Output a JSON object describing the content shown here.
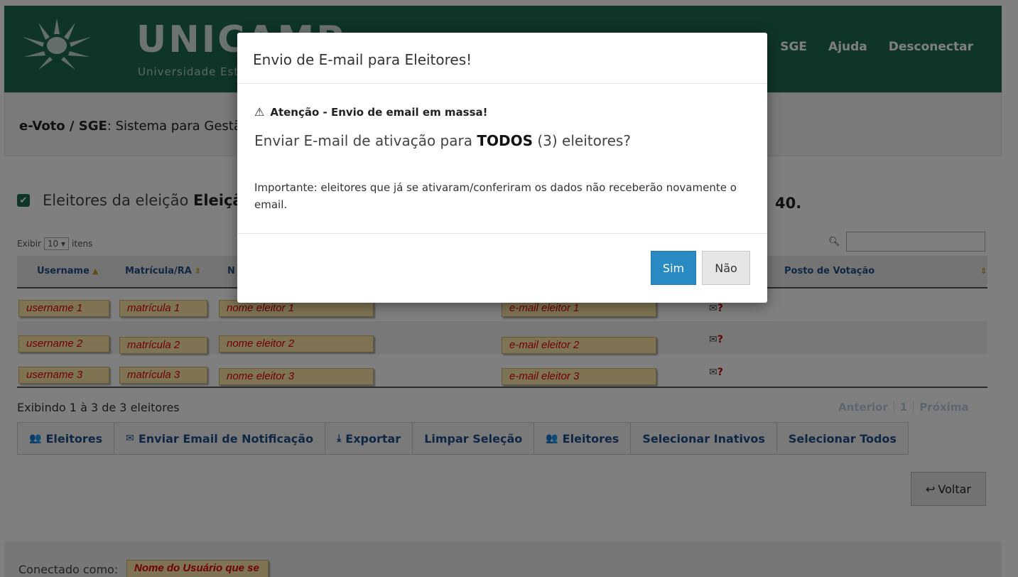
{
  "header": {
    "brand": "UNICAMP",
    "brand_sub": "Universidade Estadual de Campinas",
    "nav": [
      "SGE",
      "Ajuda",
      "Desconectar"
    ]
  },
  "title": {
    "prefix": "e-Voto / SGE",
    "text": ": Sistema para Gestão de Eleições"
  },
  "section": {
    "lead": "Eleitores da eleição",
    "election_name": "Eleição",
    "end_fragment": "40."
  },
  "table_controls": {
    "exibir_label": "Exibir",
    "per_page": "10",
    "itens_label": "itens"
  },
  "columns": [
    {
      "label": "Username",
      "sort": "▲"
    },
    {
      "label": "Matrícula/RA",
      "sort": "⇕"
    },
    {
      "label": "N",
      "sort": ""
    },
    {
      "label": "Posto de Votação",
      "sort": "⇕"
    }
  ],
  "rows": [
    {
      "username": "username 1",
      "matricula": "matrícula 1",
      "nome": "nome eleitor 1",
      "email": "e-mail eleitor 1"
    },
    {
      "username": "username 2",
      "matricula": "matrícula 2",
      "nome": "nome eleitor 2",
      "email": "e-mail eleitor 2"
    },
    {
      "username": "username 3",
      "matricula": "matrícula 3",
      "nome": "nome eleitor 3",
      "email": "e-mail eleitor 3"
    }
  ],
  "row_icons": {
    "envelope": "✉",
    "question": "?"
  },
  "exibindo": "Exibindo 1 à 3 de 3 eleitores",
  "pager": {
    "prev": "Anterior",
    "page": "1",
    "next": "Próxima"
  },
  "actions": [
    {
      "icon": "👥",
      "label": "Eleitores"
    },
    {
      "icon": "✉",
      "label": "Enviar Email de Notificação"
    },
    {
      "icon": "⤓",
      "label": "Exportar"
    },
    {
      "icon": "",
      "label": "Limpar Seleção"
    },
    {
      "icon": "👥",
      "label": "Eleitores"
    },
    {
      "icon": "",
      "label": "Selecionar Inativos"
    },
    {
      "icon": "",
      "label": "Selecionar Todos"
    }
  ],
  "voltar": "Voltar",
  "footer": {
    "connected_as": "Conectado como:",
    "user_tag": "Nome do Usuário que se autenticou"
  },
  "modal": {
    "title": "Envio de E-mail para Eleitores!",
    "warning": "Atenção - Envio de email em massa!",
    "question_pre": "Enviar E-mail de ativação para ",
    "question_bold": "TODOS",
    "question_post": " (3) eleitores?",
    "important": "Importante: eleitores que já se ativaram/conferiram os dados não receberão novamente o email.",
    "btn_yes": "Sim",
    "btn_no": "Não"
  },
  "colors": {
    "header_green": "#1f6a55",
    "link_blue": "#1f4f8a",
    "primary_button": "#2a8bc4",
    "annotation_fill": "#fde9a6",
    "annotation_text": "#e00000"
  }
}
